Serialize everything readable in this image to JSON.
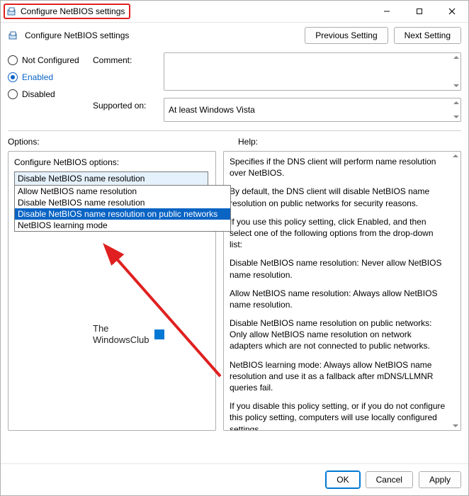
{
  "title": "Configure NetBIOS settings",
  "header": {
    "policy_name": "Configure NetBIOS settings",
    "prev_label": "Previous Setting",
    "next_label": "Next Setting"
  },
  "radios": {
    "not_configured": "Not Configured",
    "enabled": "Enabled",
    "disabled": "Disabled",
    "selected": "enabled"
  },
  "comment_label": "Comment:",
  "comment_value": "",
  "supported_label": "Supported on:",
  "supported_value": "At least Windows Vista",
  "options_label": "Options:",
  "help_label": "Help:",
  "options": {
    "heading": "Configure NetBIOS options:",
    "selected": "Disable NetBIOS name resolution",
    "items": [
      "Allow NetBIOS name resolution",
      "Disable NetBIOS name resolution",
      "Disable NetBIOS name resolution on public networks",
      "NetBIOS learning mode"
    ],
    "highlight_index": 2
  },
  "help_paragraphs": [
    "Specifies if the DNS client will perform name resolution over NetBIOS.",
    "By default, the DNS client will disable NetBIOS name resolution on public networks for security reasons.",
    "If you use this policy setting, click Enabled, and then select one of the following options from the drop-down list:",
    "Disable NetBIOS name resolution: Never allow NetBIOS name resolution.",
    "Allow NetBIOS name resolution: Always allow NetBIOS name resolution.",
    "Disable NetBIOS name resolution on public networks: Only allow NetBIOS name resolution on network adapters which are not connected to public networks.",
    "NetBIOS learning mode: Always allow NetBIOS name resolution and use it as a fallback after mDNS/LLMNR queries fail.",
    "If you disable this policy setting, or if you do not configure this policy setting, computers will use locally configured settings."
  ],
  "footer": {
    "ok": "OK",
    "cancel": "Cancel",
    "apply": "Apply"
  },
  "watermark": {
    "line1": "The",
    "line2": "WindowsClub"
  }
}
